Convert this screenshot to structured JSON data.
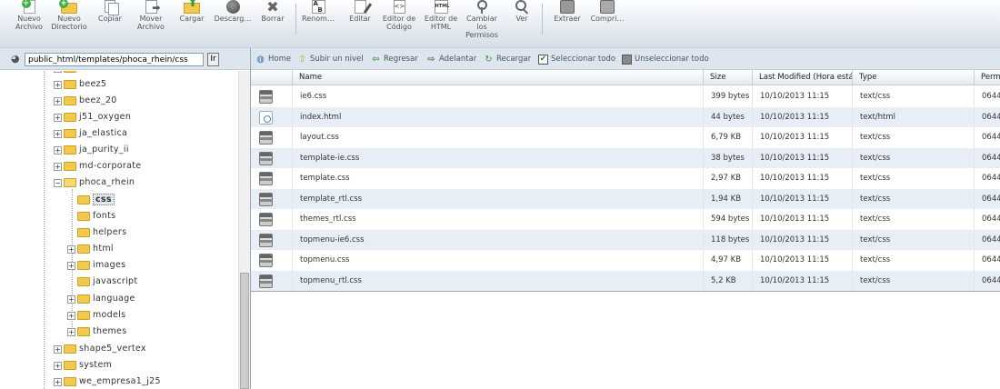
{
  "toolbar": {
    "buttons": [
      {
        "id": "new-file",
        "label": "Nuevo Archivo",
        "icon": "new-file-icon"
      },
      {
        "id": "new-folder",
        "label": "Nuevo Directorio",
        "icon": "new-folder-icon"
      },
      {
        "id": "copy",
        "label": "Copiar",
        "icon": "copy-icon"
      },
      {
        "id": "move",
        "label": "Mover Archivo",
        "icon": "move-icon"
      },
      {
        "id": "upload",
        "label": "Cargar",
        "icon": "upload-icon"
      },
      {
        "id": "download",
        "label": "Descarg…",
        "icon": "download-icon"
      },
      {
        "id": "delete",
        "label": "Borrar",
        "icon": "delete-icon"
      },
      {
        "id": "rename",
        "label": "Renom…",
        "icon": "rename-icon"
      },
      {
        "id": "edit",
        "label": "Editar",
        "icon": "edit-icon"
      },
      {
        "id": "code-editor",
        "label": "Editor de Código",
        "icon": "code-editor-icon"
      },
      {
        "id": "html-editor",
        "label": "Editor de HTML",
        "icon": "html-editor-icon"
      },
      {
        "id": "change-permissions",
        "label": "Cambiar los Permisos",
        "icon": "key-icon"
      },
      {
        "id": "view",
        "label": "Ver",
        "icon": "magnifier-icon"
      },
      {
        "id": "extract",
        "label": "Extraer",
        "icon": "extract-icon"
      },
      {
        "id": "compress",
        "label": "Compri…",
        "icon": "compress-icon"
      }
    ]
  },
  "path": {
    "value": "public_html/templates/phoca_rhein/css",
    "go_label": "Ir"
  },
  "tree": {
    "items": [
      {
        "label": "atomic",
        "expander": "+"
      },
      {
        "label": "beez5",
        "expander": "+"
      },
      {
        "label": "beez_20",
        "expander": "+"
      },
      {
        "label": "j51_oxygen",
        "expander": "+"
      },
      {
        "label": "ja_elastica",
        "expander": "+"
      },
      {
        "label": "ja_purity_ii",
        "expander": "+"
      },
      {
        "label": "md-corporate",
        "expander": "+"
      },
      {
        "label": "phoca_rhein",
        "expander": "−"
      },
      {
        "label": "css",
        "expander": ""
      },
      {
        "label": "fonts",
        "expander": ""
      },
      {
        "label": "helpers",
        "expander": ""
      },
      {
        "label": "html",
        "expander": "+"
      },
      {
        "label": "images",
        "expander": "+"
      },
      {
        "label": "javascript",
        "expander": ""
      },
      {
        "label": "language",
        "expander": "+"
      },
      {
        "label": "models",
        "expander": "+"
      },
      {
        "label": "themes",
        "expander": "+"
      },
      {
        "label": "shape5_vertex",
        "expander": "+"
      },
      {
        "label": "system",
        "expander": "+"
      },
      {
        "label": "we_empresa1_j25",
        "expander": "+"
      }
    ]
  },
  "actions": [
    {
      "label": "Home",
      "icon": "home-icon"
    },
    {
      "label": "Subir un nivel",
      "icon": "up-level-icon"
    },
    {
      "label": "Regresar",
      "icon": "back-arrow-icon"
    },
    {
      "label": "Adelantar",
      "icon": "forward-arrow-icon"
    },
    {
      "label": "Recargar",
      "icon": "reload-icon"
    },
    {
      "label": "Seleccionar todo",
      "icon": "checkbox-checked-icon"
    },
    {
      "label": "Unseleccionar todo",
      "icon": "checkbox-unchecked-icon"
    }
  ],
  "table": {
    "columns": [
      "Name",
      "Size",
      "Last Modified (Hora está",
      "Type",
      "Perm"
    ],
    "rows": [
      {
        "icon": "css",
        "name": "ie6.css",
        "size": "399 bytes",
        "modified": "10/10/2013 11:15",
        "type": "text/css",
        "perm": "0644"
      },
      {
        "icon": "html",
        "name": "index.html",
        "size": "44 bytes",
        "modified": "10/10/2013 11:15",
        "type": "text/html",
        "perm": "0644"
      },
      {
        "icon": "css",
        "name": "layout.css",
        "size": "6,79 KB",
        "modified": "10/10/2013 11:15",
        "type": "text/css",
        "perm": "0644"
      },
      {
        "icon": "css",
        "name": "template-ie.css",
        "size": "38 bytes",
        "modified": "10/10/2013 11:15",
        "type": "text/css",
        "perm": "0644"
      },
      {
        "icon": "css",
        "name": "template.css",
        "size": "2,97 KB",
        "modified": "10/10/2013 11:15",
        "type": "text/css",
        "perm": "0644"
      },
      {
        "icon": "css",
        "name": "template_rtl.css",
        "size": "1,94 KB",
        "modified": "10/10/2013 11:15",
        "type": "text/css",
        "perm": "0644"
      },
      {
        "icon": "css",
        "name": "themes_rtl.css",
        "size": "594 bytes",
        "modified": "10/10/2013 11:15",
        "type": "text/css",
        "perm": "0644"
      },
      {
        "icon": "css",
        "name": "topmenu-ie6.css",
        "size": "118 bytes",
        "modified": "10/10/2013 11:15",
        "type": "text/css",
        "perm": "0644"
      },
      {
        "icon": "css",
        "name": "topmenu.css",
        "size": "4,97 KB",
        "modified": "10/10/2013 11:15",
        "type": "text/css",
        "perm": "0644"
      },
      {
        "icon": "css",
        "name": "topmenu_rtl.css",
        "size": "5,2 KB",
        "modified": "10/10/2013 11:15",
        "type": "text/css",
        "perm": "0644"
      }
    ]
  }
}
